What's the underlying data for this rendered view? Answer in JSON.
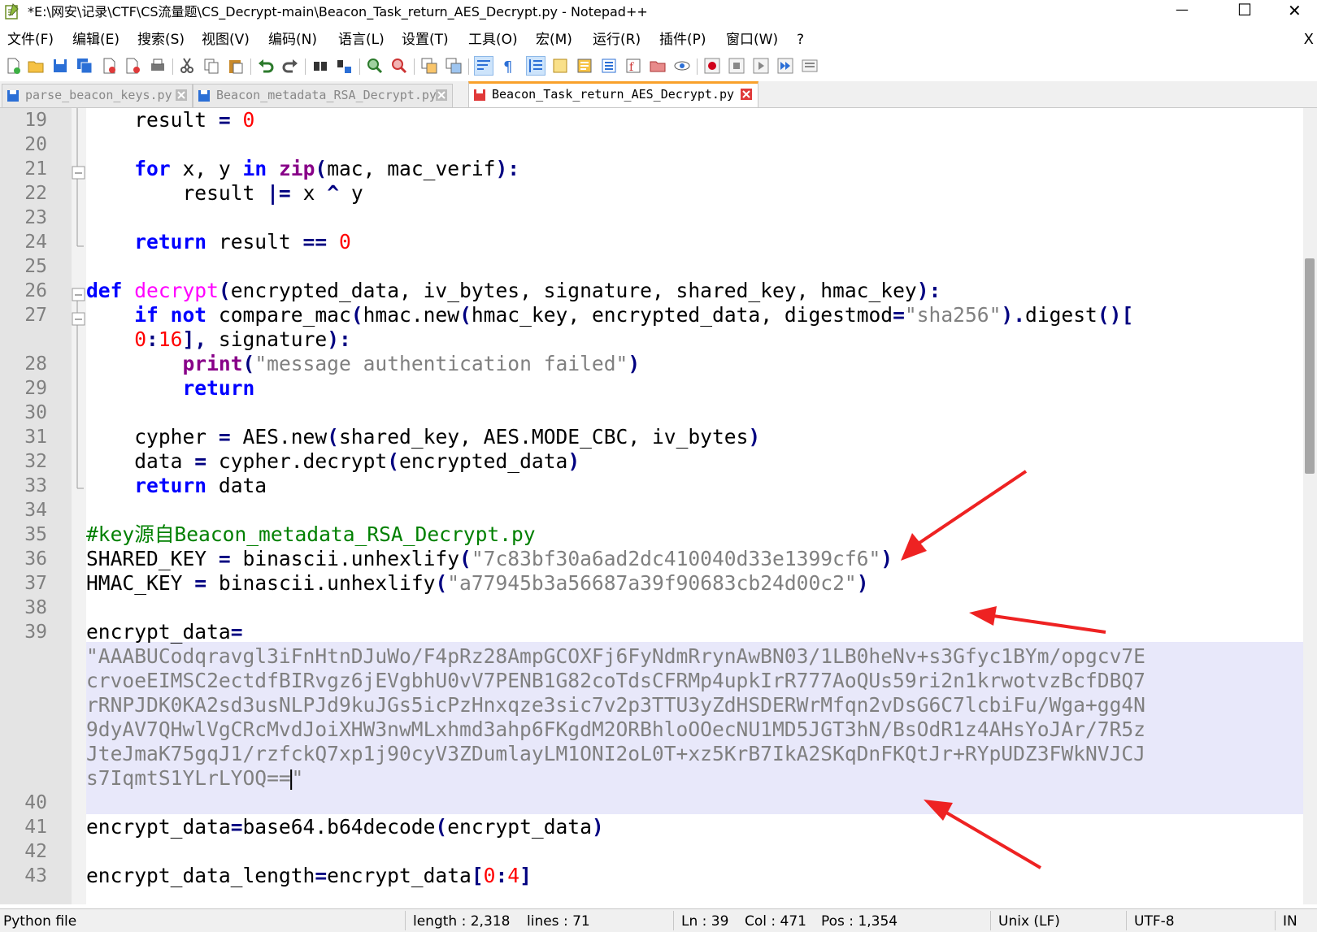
{
  "window": {
    "title": "*E:\\网安\\记录\\CTF\\CS流量题\\CS_Decrypt-main\\Beacon_Task_return_AES_Decrypt.py - Notepad++",
    "minimize_glyph": "—",
    "maximize_glyph": "☐",
    "close_glyph": "✕"
  },
  "menu": {
    "items": [
      "文件(F)",
      "编辑(E)",
      "搜索(S)",
      "视图(V)",
      "编码(N)",
      "语言(L)",
      "设置(T)",
      "工具(O)",
      "宏(M)",
      "运行(R)",
      "插件(P)",
      "窗口(W)",
      "?"
    ],
    "close_doc": "X"
  },
  "tabs": [
    {
      "label": "parse_beacon_keys.py",
      "active": false,
      "icon": "saved-file-icon",
      "icon_color": "#2b6fd6"
    },
    {
      "label": "Beacon_metadata_RSA_Decrypt.py",
      "active": false,
      "icon": "saved-file-icon",
      "icon_color": "#2b6fd6"
    },
    {
      "label": "Beacon_Task_return_AES_Decrypt.py",
      "active": true,
      "icon": "unsaved-file-icon",
      "icon_color": "#e03a3a"
    }
  ],
  "editor": {
    "line_numbers": [
      "19",
      "20",
      "21",
      "22",
      "23",
      "24",
      "25",
      "26",
      "27",
      "",
      "28",
      "29",
      "30",
      "31",
      "32",
      "33",
      "34",
      "35",
      "36",
      "37",
      "38",
      "39",
      "",
      "",
      "",
      "",
      "",
      "",
      "40",
      "41",
      "42",
      "43"
    ],
    "code": {
      "l19_var": "result",
      "l19_op": "=",
      "l19_num": "0",
      "l21_for": "for",
      "l21_mid": "x, y",
      "l21_in": "in",
      "l21_zip": "zip",
      "l21_paren": "(",
      "l21_args": "mac, mac_verif",
      "l21_end": "):",
      "l22_var": "result",
      "l22_op": "|=",
      "l22_x": "x",
      "l22_xor": "^",
      "l22_y": "y",
      "l24_return": "return",
      "l24_var": "result",
      "l24_op": "==",
      "l24_num": "0",
      "l26_def": "def",
      "l26_fn": "decrypt",
      "l26_paren": "(",
      "l26_args": "encrypted_data, iv_bytes, signature, shared_key, hmac_key",
      "l26_end": "):",
      "l27_if": "if",
      "l27_not": "not",
      "l27_call": "compare_mac",
      "l27_p1": "(",
      "l27_hmacnew": "hmac.new",
      "l27_p2": "(",
      "l27_args": "hmac_key, encrypted_data, digestmod",
      "l27_eq": "=",
      "l27_str": "\"sha256\"",
      "l27_close": ").",
      "l27_digest": "digest",
      "l27_tail": "()[",
      "l27b_num1": "0",
      "l27b_colon": ":",
      "l27b_num2": "16",
      "l27b_rb": "],",
      "l27b_sig": "signature",
      "l27b_end": "):",
      "l28_print": "print",
      "l28_p": "(",
      "l28_str": "\"message authentication failed\"",
      "l28_end": ")",
      "l29_return": "return",
      "l31_var": "cypher",
      "l31_op": "=",
      "l31_call": "AES.new",
      "l31_p": "(",
      "l31_args": "shared_key, AES.MODE_CBC, iv_bytes",
      "l31_end": ")",
      "l32_var": "data",
      "l32_op": "=",
      "l32_call": "cypher.decrypt",
      "l32_p": "(",
      "l32_args": "encrypted_data",
      "l32_end": ")",
      "l33_return": "return",
      "l33_var": "data",
      "l35_comment": "#key源自Beacon_metadata_RSA_Decrypt.py",
      "l36_var": "SHARED_KEY",
      "l36_op": "=",
      "l36_call": "binascii.unhexlify",
      "l36_p": "(",
      "l36_str": "\"7c83bf30a6ad2dc410040d33e1399cf6\"",
      "l36_end": ")",
      "l37_var": "HMAC_KEY",
      "l37_op": "=",
      "l37_call": "binascii.unhexlify",
      "l37_p": "(",
      "l37_str": "\"a77945b3a56687a39f90683cb24d00c2\"",
      "l37_end": ")",
      "l39_var": "encrypt_data",
      "l39_op": "=",
      "l39_s1": "\"AAABUCodqravgl3iFnHtnDJuWo/F4pRz28AmpGCOXFj6FyNdmRrynAwBN03/1LB0heNv+s3Gfyc1BYm/opgcv7E",
      "l39_s2": "crvoeEIMSC2ectdfBIRvgz6jEVgbhU0vV7PENB1G82coTdsCFRMp4upkIrR777AoQUs59ri2n1krwotvzBcfDBQ7",
      "l39_s3": "rRNPJDK0KA2sd3usNLPJd9kuJGs5icPzHnxqze3sic7v2p3TTU3yZdHSDERWrMfqn2vDsG6C7lcbiFu/Wga+gg4N",
      "l39_s4": "9dyAV7QHwlVgCRcMvdJoiXHW3nwMLxhmd3ahp6FKgdM2ORBhloOOecNU1MD5JGT3hN/BsOdR1z4AHsYoJAr/7R5z",
      "l39_s5": "JteJmaK75gqJ1/rzfckQ7xp1j90cyV3ZDumlayLM1ONI2oL0T+xz5KrB7IkA2SKqDnFKQtJr+RYpUDZ3FWkNVJCJ",
      "l39_s6": "s7IqmtS1YLrLYOQ==",
      "l39_caret": "|",
      "l39_s6end": "\"",
      "l41_var": "encrypt_data",
      "l41_op": "=",
      "l41_call": "base64.b64decode",
      "l41_p": "(",
      "l41_args": "encrypt_data",
      "l41_end": ")",
      "l43_text": "encrypt_data_length",
      "l43_op": "=",
      "l43_var": "encrypt_data",
      "l43_br": "[",
      "l43_n0": "0",
      "l43_colon": ":",
      "l43_n4": "4",
      "l43_end": "]"
    }
  },
  "status": {
    "file_type": "Python file",
    "length": "length : 2,318",
    "lines": "lines : 71",
    "ln": "Ln : 39",
    "col": "Col : 471",
    "pos": "Pos : 1,354",
    "eol": "Unix (LF)",
    "encoding": "UTF-8",
    "mode": "IN"
  },
  "annotation_color": "#ee2222"
}
